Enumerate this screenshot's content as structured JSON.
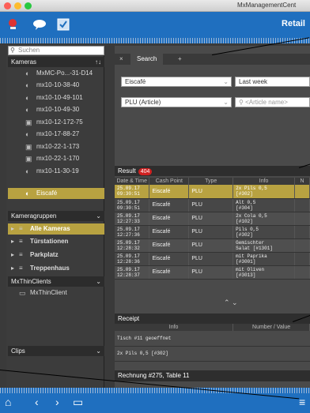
{
  "window": {
    "title": "MxManagementCent"
  },
  "toolbar": {
    "retail_label": "Retail"
  },
  "sidebar": {
    "search_placeholder": "Suchen",
    "cameras_header": "Kameras",
    "cameras_sort": "↑↓",
    "cameras": [
      "MxMC-Po...-31-D14",
      "mx10-10-38-40",
      "mx10-10-49-101",
      "mx10-10-49-30",
      "mx10-12-172-75",
      "mx10-17-88-27",
      "mx10-22-1-173",
      "mx10-22-1-170",
      "mx10-11-30-19",
      "Eiscafé"
    ],
    "groups_header": "Kameragruppen",
    "groups": [
      "Alle Kameras",
      "Türstationen",
      "Parkplatz",
      "Treppenhaus"
    ],
    "thinclients_header": "MxThinClients",
    "thinclients": [
      "MxThinClient"
    ],
    "clips_header": "Clips"
  },
  "main": {
    "search_tab": "Search",
    "add_tab": "+",
    "location_value": "Eiscafé",
    "period_value": "Last week",
    "type_value": "PLU (Article)",
    "article_placeholder": "<Article name>",
    "result_label": "Result",
    "result_count": "404",
    "columns": [
      "Date & Time",
      "Cash Point",
      "Type",
      "Info",
      "N"
    ],
    "rows": [
      {
        "date": "25.09.17\n09:30:51",
        "cash": "Eiscafé",
        "type": "PLU",
        "info": "2x Pils 0,5\n[#302]"
      },
      {
        "date": "25.09.17\n09:30:51",
        "cash": "Eiscafé",
        "type": "PLU",
        "info": "Alt 0,5\n[#304]"
      },
      {
        "date": "25.09.17\n12:27:33",
        "cash": "Eiscafé",
        "type": "PLU",
        "info": "2x Cola 0,5\n[#102]"
      },
      {
        "date": "25.09.17\n12:27:36",
        "cash": "Eiscafé",
        "type": "PLU",
        "info": "Pils 0,5\n[#302]"
      },
      {
        "date": "25.09.17\n12:28:32",
        "cash": "Eiscafé",
        "type": "PLU",
        "info": "Gemischter\nSalat [#1301]"
      },
      {
        "date": "25.09.17\n12:28:36",
        "cash": "Eiscafé",
        "type": "PLU",
        "info": "mit Paprika\n[#3001]"
      },
      {
        "date": "25.09.17\n12:28:37",
        "cash": "Eiscafé",
        "type": "PLU",
        "info": "mit Oliven\n[#3013]"
      }
    ],
    "receipt_label": "Receipt",
    "receipt_columns": [
      "Info",
      "Number / Value"
    ],
    "receipt_rows": [
      "Tisch #11 geoeffnet",
      "2x Pils 0,5 [#302]"
    ],
    "receipt_footer": "Rechnung #275, Table 11"
  },
  "colors": {
    "accent": "#1f6fbf",
    "selection": "#b8a241",
    "badge": "#d02020"
  }
}
